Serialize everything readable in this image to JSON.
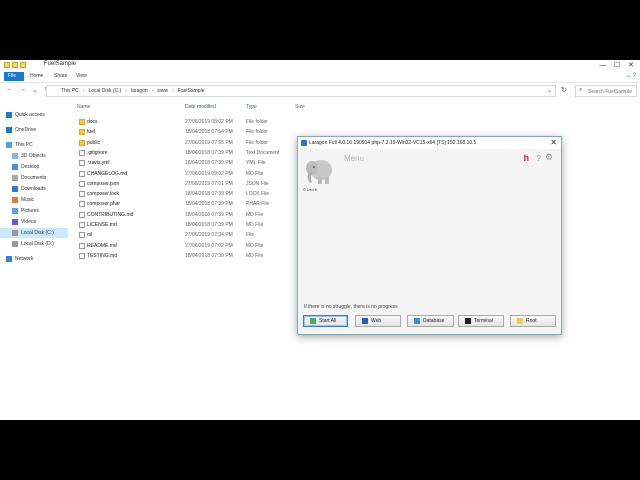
{
  "explorer": {
    "title": "FuelSample",
    "ribbon_tabs": [
      "File",
      "Home",
      "Share",
      "View"
    ],
    "breadcrumbs": [
      "This PC",
      "Local Disk (C:)",
      "laragon",
      "www",
      "FuelSample"
    ],
    "search_placeholder": "Search FuelSample",
    "nav": [
      {
        "label": "Quick access",
        "icon": "star-icon"
      },
      {
        "label": "OneDrive",
        "icon": "cloud-icon"
      },
      {
        "label": "This PC",
        "icon": "computer-icon"
      },
      {
        "label": "3D Objects",
        "icon": "cube-icon"
      },
      {
        "label": "Desktop",
        "icon": "desktop-icon"
      },
      {
        "label": "Documents",
        "icon": "documents-icon"
      },
      {
        "label": "Downloads",
        "icon": "download-icon"
      },
      {
        "label": "Music",
        "icon": "music-icon"
      },
      {
        "label": "Pictures",
        "icon": "pictures-icon"
      },
      {
        "label": "Videos",
        "icon": "videos-icon"
      },
      {
        "label": "Local Disk (C:)",
        "icon": "drive-icon"
      },
      {
        "label": "Local Disk (D:)",
        "icon": "drive-icon"
      },
      {
        "label": "Network",
        "icon": "network-icon"
      }
    ],
    "columns": [
      "Name",
      "Date modified",
      "Type",
      "Size"
    ],
    "files": [
      {
        "name": "docs",
        "date": "27/06/2019 08:02 PM",
        "type": "File folder",
        "kind": "folder"
      },
      {
        "name": "fuel",
        "date": "18/04/2018 07:54 PM",
        "type": "File folder",
        "kind": "folder"
      },
      {
        "name": "public",
        "date": "27/06/2019 07:55 PM",
        "type": "File folder",
        "kind": "folder"
      },
      {
        "name": ".gitignore",
        "date": "18/04/2018 07:39 PM",
        "type": "Text Document",
        "kind": "file"
      },
      {
        "name": ".travis.yml",
        "date": "18/04/2018 07:39 PM",
        "type": "YML File",
        "kind": "file"
      },
      {
        "name": "CHANGELOG.md",
        "date": "27/06/2019 09:02 PM",
        "type": "MD File",
        "kind": "file"
      },
      {
        "name": "composer.json",
        "date": "27/06/2019 07:01 PM",
        "type": "JSON File",
        "kind": "file"
      },
      {
        "name": "composer.lock",
        "date": "18/04/2018 07:39 PM",
        "type": "LOCK File",
        "kind": "file"
      },
      {
        "name": "composer.phar",
        "date": "18/04/2018 07:39 PM",
        "type": "PHAR File",
        "kind": "file"
      },
      {
        "name": "CONTRIBUTING.md",
        "date": "18/04/2018 07:39 PM",
        "type": "MD File",
        "kind": "file"
      },
      {
        "name": "LICENSE.md",
        "date": "18/04/2018 07:39 PM",
        "type": "MD File",
        "kind": "file"
      },
      {
        "name": "oil",
        "date": "27/06/2019 07:34 PM",
        "type": "File",
        "kind": "file"
      },
      {
        "name": "README.md",
        "date": "27/06/2019 07:02 PM",
        "type": "MD File",
        "kind": "file"
      },
      {
        "name": "TESTING.md",
        "date": "18/04/2018 07:39 PM",
        "type": "MD File",
        "kind": "file"
      }
    ]
  },
  "laragon": {
    "title": "Laragon Full 4.0.16 190914 php-7.2.19-Win32-VC15-x64 [TS]  192.168.10.5",
    "menu_label": "Menu",
    "logo_caption": "© Leo K",
    "status_text": "If there is no struggle, there is no progress",
    "buttons": [
      {
        "label": "Start All",
        "icon": "start-icon",
        "color": "#4caf50"
      },
      {
        "label": "Web",
        "icon": "globe-icon",
        "color": "#2a5fb0"
      },
      {
        "label": "Database",
        "icon": "database-icon",
        "color": "#3a8fd6"
      },
      {
        "label": "Terminal",
        "icon": "terminal-icon",
        "color": "#222222"
      },
      {
        "label": "Root",
        "icon": "folder-icon",
        "color": "#f3c94d"
      }
    ],
    "accent_h_color": "#e22233"
  }
}
